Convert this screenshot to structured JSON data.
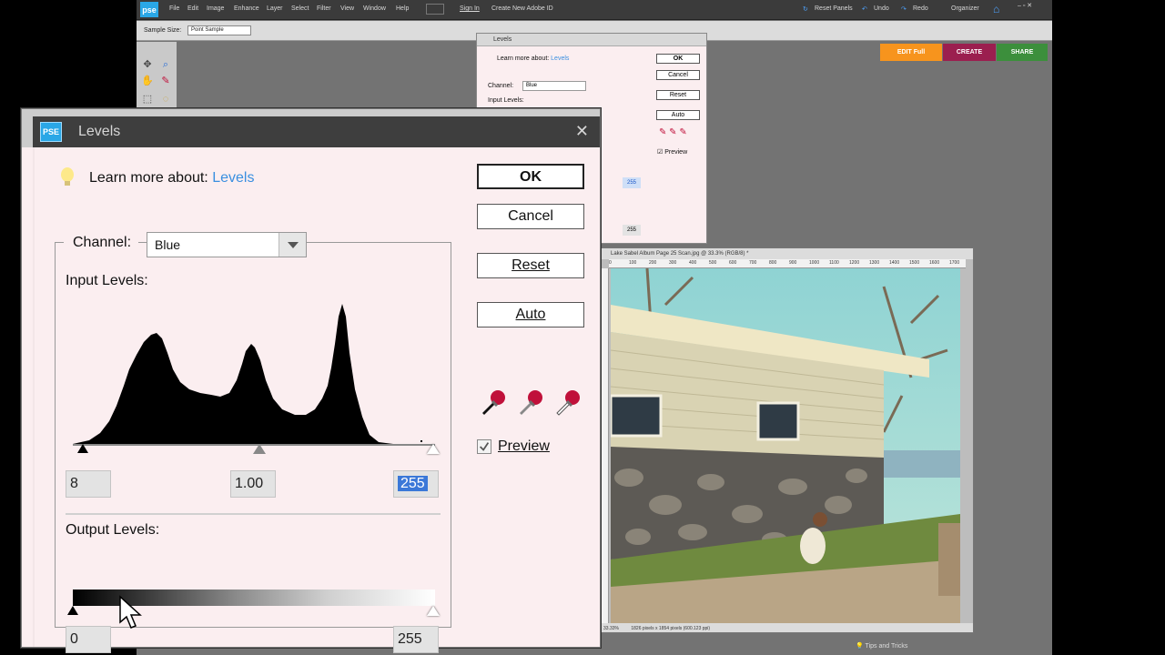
{
  "app": {
    "logo": "pse",
    "menu": [
      "File",
      "Edit",
      "Image",
      "Enhance",
      "Layer",
      "Select",
      "Filter",
      "View",
      "Window",
      "Help"
    ],
    "sign_in": "Sign In",
    "create_id": "Create New Adobe ID",
    "reset_panels": "Reset Panels",
    "undo": "Undo",
    "redo": "Redo",
    "organizer": "Organizer",
    "sample_size_label": "Sample Size:",
    "sample_size_value": "Point Sample",
    "modes": {
      "edit": "EDIT Full",
      "create": "CREATE",
      "share": "SHARE"
    },
    "colors": {
      "edit": "#f7941d",
      "create": "#9b1f4f",
      "share": "#3c8f3c"
    },
    "tips": "Tips and Tricks"
  },
  "bg_dialog": {
    "title": "Levels",
    "learn_prefix": "Learn more about:",
    "learn_link": "Levels",
    "channel_label": "Channel:",
    "channel_value": "Blue",
    "input_label": "Input Levels:",
    "buttons": [
      "OK",
      "Cancel",
      "Reset",
      "Auto"
    ],
    "preview_label": "Preview",
    "val_high": "255",
    "val_out_high": "255"
  },
  "photo_window": {
    "title": "Lake Sabel Album Page 25 Scan.jpg @ 33.3% (RGB/8) *",
    "zoom": "33.33%",
    "status": "1826 pixels x 1854 pixels (600.123 ppi)",
    "ruler_ticks": [
      "0",
      "100",
      "200",
      "300",
      "400",
      "500",
      "600",
      "700",
      "800",
      "900",
      "1000",
      "1100",
      "1200",
      "1300",
      "1400",
      "1500",
      "1600",
      "1700"
    ]
  },
  "dialog": {
    "logo": "PSE",
    "title": "Levels",
    "learn_prefix": "Learn more about:",
    "learn_link": "Levels",
    "channel_label": "Channel:",
    "channel_value": "Blue",
    "input_label": "Input Levels:",
    "input_black": "8",
    "input_gamma": "1.00",
    "input_white": "255",
    "output_label": "Output Levels:",
    "output_black": "0",
    "output_white": "255",
    "buttons": {
      "ok": "OK",
      "cancel": "Cancel",
      "reset": "Reset",
      "auto": "Auto"
    },
    "preview_label": "Preview",
    "preview_checked": true,
    "icons": [
      "lightbulb-icon",
      "close-icon",
      "black-eyedropper-icon",
      "gray-eyedropper-icon",
      "white-eyedropper-icon"
    ]
  }
}
